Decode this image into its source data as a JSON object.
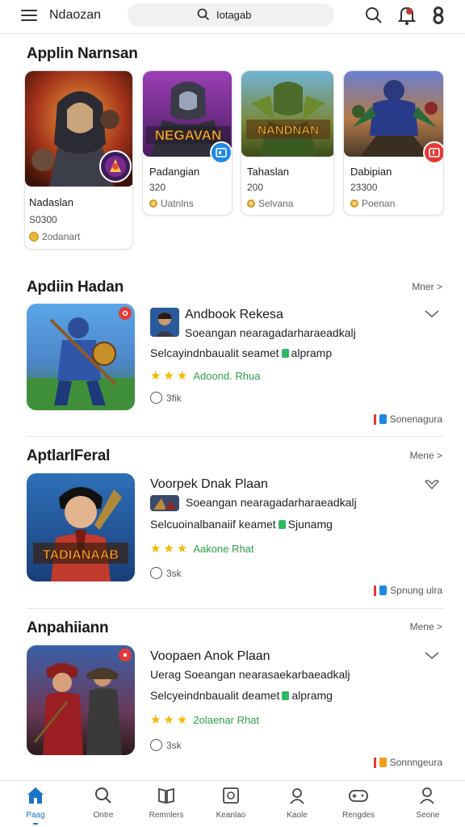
{
  "header": {
    "app_title": "Ndaozan",
    "search_text": "Iotagab"
  },
  "featured": {
    "title": "Applin Narnsan",
    "cards": [
      {
        "name": "Nadaslan",
        "price": "S0300",
        "meta": "2odanart"
      },
      {
        "name": "Padangian",
        "price": "320",
        "meta": "Uatnlns",
        "art_text": "NEGAVAN"
      },
      {
        "name": "Tahaslan",
        "price": "200",
        "meta": "Selvana",
        "art_text": "NANDNAN"
      },
      {
        "name": "Dabipian",
        "price": "23300",
        "meta": "Poenan"
      }
    ]
  },
  "sections": [
    {
      "title": "Apdiin Hadan",
      "more": "Mner >",
      "item": {
        "title": "Andbook Rekesa",
        "line1": "Soeangan nearagadarharaeadkalj",
        "line2a": "Selcayindnbaualit seamet",
        "line2b": "alpramp",
        "rating_text": "Adoond. Rhua",
        "comments": "3fik",
        "footer": "Sonenagura"
      }
    },
    {
      "title": "AptlarlFeral",
      "more": "Mene >",
      "item": {
        "title": "Voorpek Dnak Plaan",
        "line1": "Soeangan nearagadarharaeadkalj",
        "line2a": "Selcuoinalbanaiif keamet",
        "line2b": "Sjunamg",
        "rating_text": "Aakone Rhat",
        "comments": "3sk",
        "footer": "Spnung ulra",
        "art_text": "TADIANAAB"
      }
    },
    {
      "title": "Anpahiiann",
      "more": "Mene >",
      "item": {
        "title": "Voopaen Anok Plaan",
        "line1": "Uerag Soeangan nearasaekarbaeadkalj",
        "line2a": "Selcyeindnbaualit deamet",
        "line2b": "alpramg",
        "rating_text": "2olaenar Rhat",
        "comments": "3sk",
        "footer": "Sonnngeura"
      }
    }
  ],
  "bottom_nav": [
    {
      "label": "Paag",
      "icon": "home-icon"
    },
    {
      "label": "Ontre",
      "icon": "search-icon"
    },
    {
      "label": "Remnlers",
      "icon": "book-icon"
    },
    {
      "label": "Keanlao",
      "icon": "image-frame-icon"
    },
    {
      "label": "Kaole",
      "icon": "person-search-icon"
    },
    {
      "label": "Rengdes",
      "icon": "game-controller-icon"
    },
    {
      "label": "Seone",
      "icon": "profile-icon"
    }
  ],
  "colors": {
    "accent": "#1a73c9",
    "rating_text": "#2e9e49",
    "star": "#f5b800",
    "badge_red": "#e53935",
    "badge_blue": "#1e88e5"
  }
}
